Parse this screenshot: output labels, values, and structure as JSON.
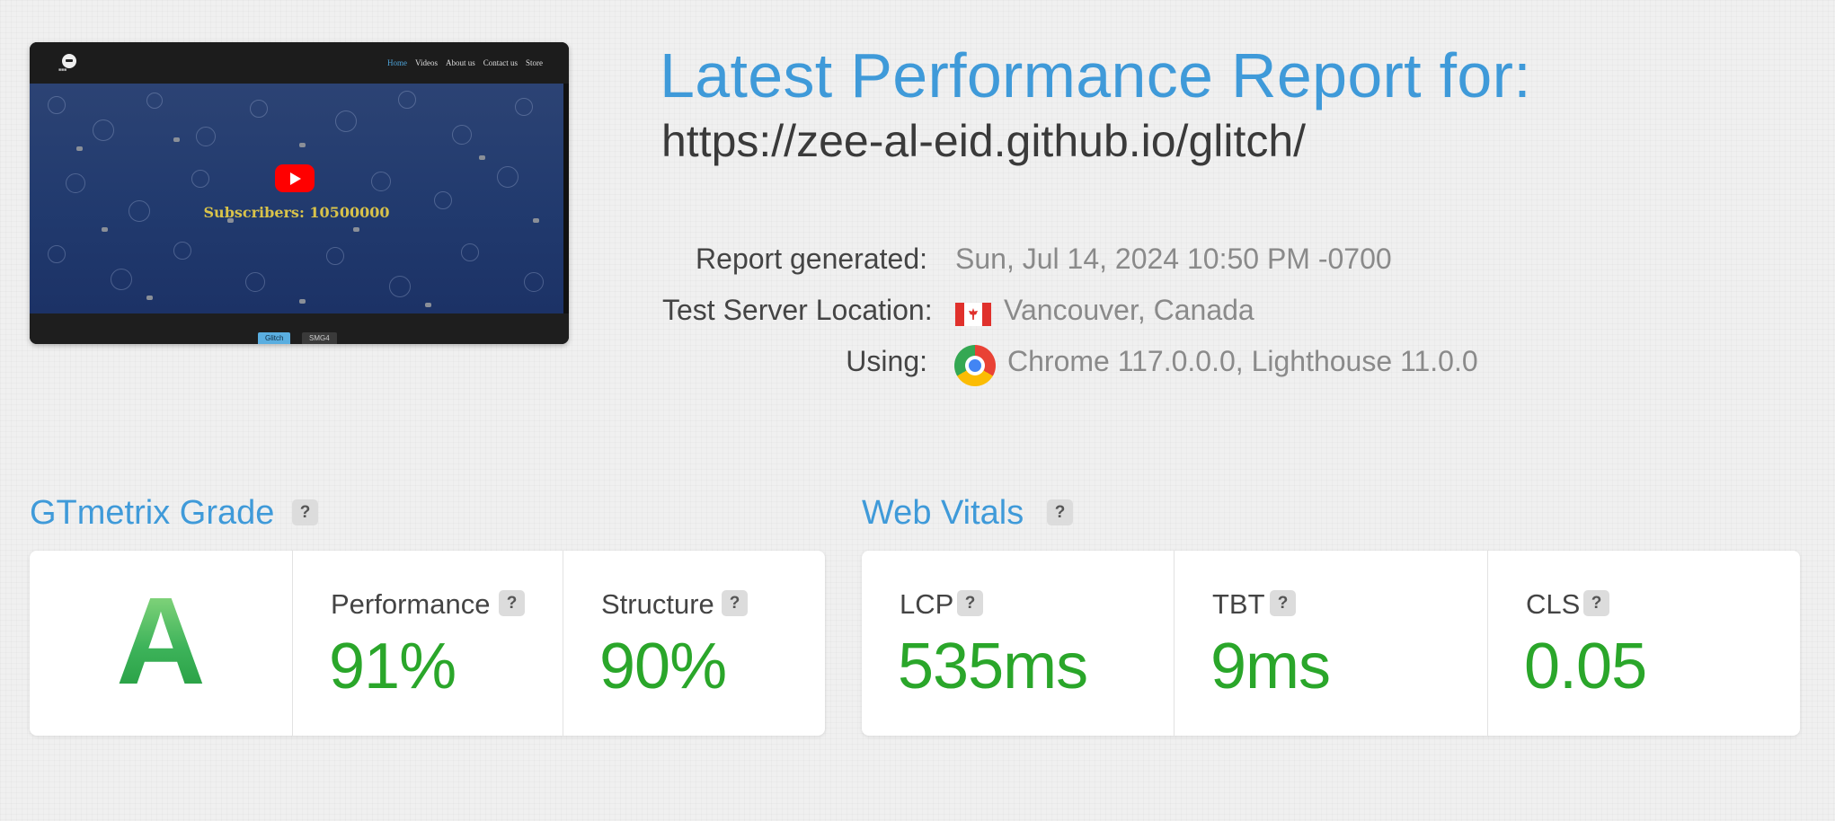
{
  "screenshot": {
    "nav_items": [
      "Home",
      "Videos",
      "About us",
      "Contact us",
      "Store"
    ],
    "subscribers_text": "Subscribers: 10500000",
    "footer_tabs": [
      "Glitch",
      "SMG4"
    ]
  },
  "header": {
    "title": "Latest Performance Report for:",
    "url": "https://zee-al-eid.github.io/glitch/"
  },
  "meta": {
    "report_generated_label": "Report generated:",
    "report_generated_value": "Sun, Jul 14, 2024 10:50 PM -0700",
    "location_label": "Test Server Location:",
    "location_value": "Vancouver, Canada",
    "location_icon": "canada-flag-icon",
    "using_label": "Using:",
    "using_value": "Chrome 117.0.0.0, Lighthouse 11.0.0",
    "using_icon": "chrome-icon"
  },
  "grade_section": {
    "title": "GTmetrix Grade",
    "grade": "A",
    "performance_label": "Performance",
    "performance_value": "91%",
    "structure_label": "Structure",
    "structure_value": "90%"
  },
  "vitals_section": {
    "title": "Web Vitals",
    "lcp_label": "LCP",
    "lcp_value": "535ms",
    "tbt_label": "TBT",
    "tbt_value": "9ms",
    "cls_label": "CLS",
    "cls_value": "0.05"
  },
  "help_symbol": "?",
  "colors": {
    "accent": "#3f9ad9",
    "good": "#2aa62a",
    "background": "#f0f0f0"
  }
}
